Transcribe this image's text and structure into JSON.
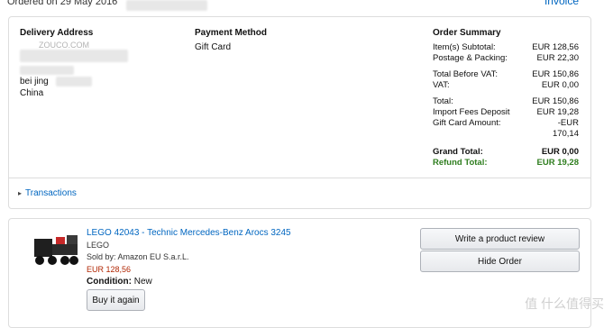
{
  "header": {
    "order_date": "Ordered on 29 May 2016",
    "invoice_label": "Invoice"
  },
  "delivery": {
    "title": "Delivery Address",
    "lines": [
      "bei jing",
      "China"
    ]
  },
  "payment": {
    "title": "Payment Method",
    "method": "Gift Card"
  },
  "order_summary": {
    "title": "Order Summary",
    "rows": [
      {
        "label": "Item(s) Subtotal:",
        "value": "EUR 128,56"
      },
      {
        "label": "Postage & Packing:",
        "value": "EUR 22,30"
      },
      {
        "label": "Total Before VAT:",
        "value": "EUR 150,86"
      },
      {
        "label": "VAT:",
        "value": "EUR 0,00"
      },
      {
        "label": "Total:",
        "value": "EUR 150,86"
      },
      {
        "label": "Import Fees Deposit",
        "value": "EUR 19,28"
      },
      {
        "label": "Gift Card Amount:",
        "value": "-EUR"
      },
      {
        "label": "",
        "value": "170,14"
      },
      {
        "label": "Grand Total:",
        "value": "EUR 0,00"
      },
      {
        "label": "Refund Total:",
        "value": "EUR 19,28"
      }
    ]
  },
  "transactions": {
    "label": "Transactions"
  },
  "item": {
    "title": "LEGO 42043 - Technic Mercedes-Benz Arocs 3245",
    "brand": "LEGO",
    "sold_by": "Sold by: Amazon EU S.a.r.L.",
    "price": "EUR 128,56",
    "condition_label": "Condition:",
    "condition_value": "New",
    "buy_again": "Buy it again"
  },
  "actions": {
    "write_review": "Write a product review",
    "hide_order": "Hide Order"
  },
  "watermarks": {
    "top": "ZOUCO.COM",
    "bottom": "值 什么值得买"
  }
}
